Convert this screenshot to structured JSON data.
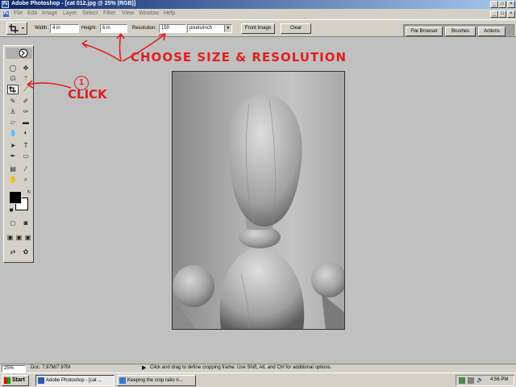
{
  "window": {
    "title": "Adobe Photoshop - [cat 012.jpg @ 25% (RGB)]",
    "controls": [
      "_",
      "□",
      "×"
    ],
    "doc_controls": [
      "_",
      "□",
      "×"
    ]
  },
  "menu": [
    "File",
    "Edit",
    "Image",
    "Layer",
    "Select",
    "Filter",
    "View",
    "Window",
    "Help"
  ],
  "options": {
    "width_label": "Width:",
    "width_value": "4 in",
    "height_label": "Height:",
    "height_value": "6 in",
    "resolution_label": "Resolution:",
    "resolution_value": "150",
    "units_value": "pixels/inch",
    "front_image_label": "Front Image",
    "clear_label": "Clear",
    "palette_tabs": [
      "File Browser",
      "Brushes",
      "Actions"
    ]
  },
  "annotations": {
    "choose_text": "CHOOSE SIZE & RESOLUTION",
    "step_number": "1",
    "click_text": "CLICK",
    "color": "#e02020"
  },
  "status": {
    "zoom": "25%",
    "doc": "Doc: 7.97M/7.97M",
    "hint": "Click and drag to define cropping frame. Use Shift, Alt, and Ctrl for additional options."
  },
  "taskbar": {
    "start_label": "Start",
    "tasks": [
      "Adobe Photoshop - [cat ...",
      "Keeping the crop ratio ri..."
    ],
    "time": "4:56 PM"
  },
  "colors": {
    "title_start": "#0a246a",
    "title_end": "#a6caf0",
    "chrome": "#d4d0c8",
    "desktop": "#c0c0c0"
  }
}
